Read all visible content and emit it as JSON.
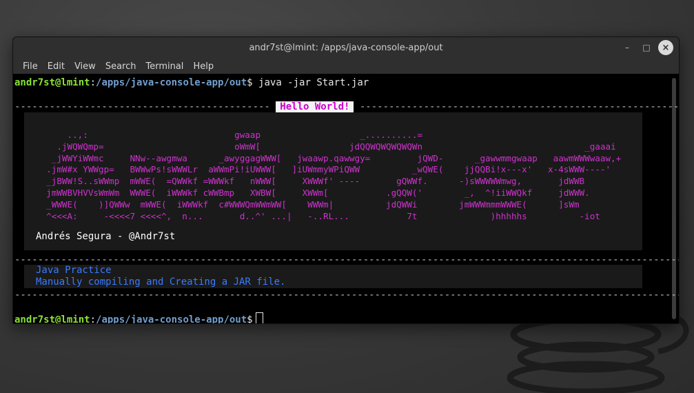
{
  "window": {
    "title": "andr7st@lmint: /apps/java-console-app/out",
    "controls": {
      "minimize": "–",
      "maximize": "□",
      "close": "×"
    }
  },
  "menu": [
    "File",
    "Edit",
    "View",
    "Search",
    "Terminal",
    "Help"
  ],
  "prompt": {
    "user": "andr7st@lmint",
    "sep": ":",
    "path": "/apps/java-console-app/out",
    "symbol": "$"
  },
  "command": " java -jar Start.jar",
  "banner_title": "Hello World!",
  "ascii_art": [
    "      ..,:                            gwaap                   _..........=",
    "    .jWQWQmp=                         oWmW[                 jdQQWQWQWQWQWn                               _gaaai",
    "   _jWWYiWWmc     NNw--awgmwa      _awyggagWWW[   jwaawp.qawwgy=         jQWD-      _gawwmmgwaap   aawmWWWwaaw,+",
    "  .jmW#x YWWgp=   BWWwPs!sWWWLr  aWWmPi!iUWWW[   ]iUWmmyWPiQWW          _wQWE(    jjQQBi!x---x'   x-4sWWW----'",
    "  _jBWW!S..sWWmp  mWWE(  =QWWkf =WWWkf   nWWW[     XWWWf' ----       gQWWf.      -)sWWWWWmwg,       jdWWB",
    "  jmWWBVHVVsWmWm  WWWE(  iWWWkf cWWBmp   XWBW[     XWWm[           .gQQW('        _,  ^!iiWWQkf     jdWWW.",
    "  _WWWE(    )]QWWw  mWWE(  iWWWkf  c#WWWQmWWmWW[    WWWm|          jdQWWi        jmWWWmmmWWWE(      ]sWm",
    "  ^<<<A:     -<<<<7 <<<<^,  n...       d..^' ...|   -..RL...           7t              )hhhhhs          -iot"
  ],
  "author": "Andrés Segura - @Andr7st",
  "info_lines": [
    "Java Practice",
    "Manually compiling and Creating a JAR file."
  ]
}
